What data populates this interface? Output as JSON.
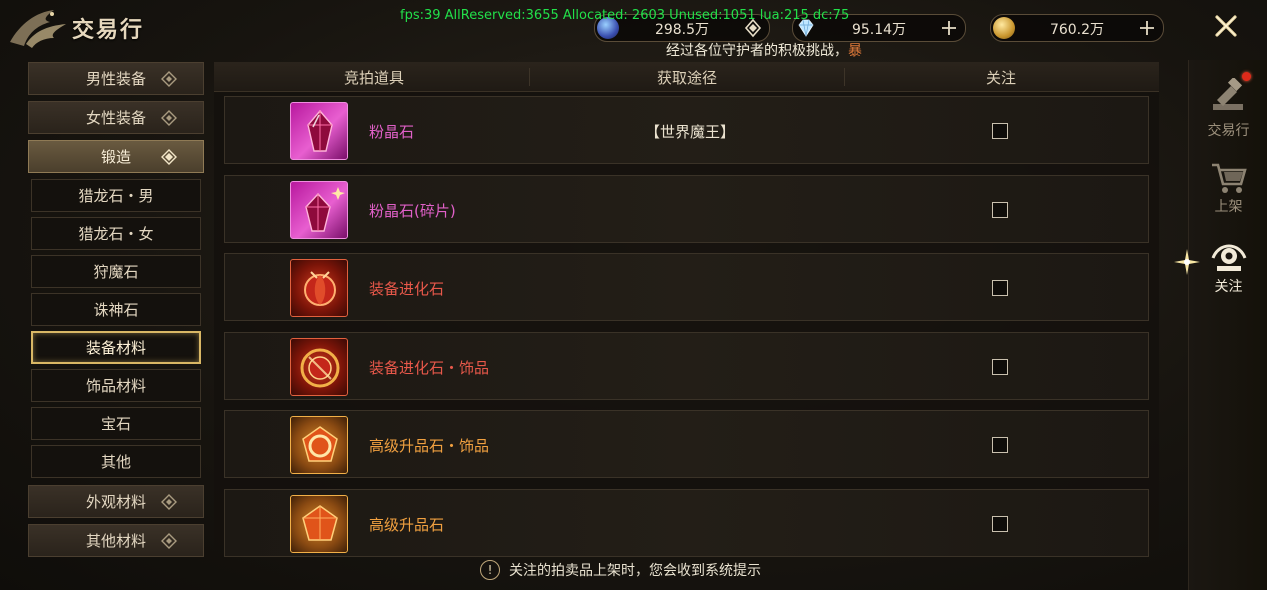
{
  "header": {
    "title": "交易行",
    "debug_overlay": "fps:39 AllReserved:3655 Allocated: 2603 Unused:1051 lua:215 dc:75",
    "notice": {
      "text": "经过各位守护者的积极挑战，",
      "highlight": "暴"
    }
  },
  "currencies": [
    {
      "icon": "blue-orb-icon",
      "value": "298.5万",
      "action": "diamond-chevron-icon"
    },
    {
      "icon": "diamond-icon",
      "value": "95.14万",
      "action": "plus-icon"
    },
    {
      "icon": "gold-coin-icon",
      "value": "760.2万",
      "action": "plus-icon"
    }
  ],
  "categories": [
    {
      "label": "男性装备",
      "type": "group",
      "state": "collapsed"
    },
    {
      "label": "女性装备",
      "type": "group",
      "state": "collapsed"
    },
    {
      "label": "锻造",
      "type": "group",
      "state": "expanded"
    },
    {
      "label": "猎龙石・男",
      "type": "sub"
    },
    {
      "label": "猎龙石・女",
      "type": "sub"
    },
    {
      "label": "狩魔石",
      "type": "sub"
    },
    {
      "label": "诛神石",
      "type": "sub"
    },
    {
      "label": "装备材料",
      "type": "sub",
      "selected": true
    },
    {
      "label": "饰品材料",
      "type": "sub"
    },
    {
      "label": "宝石",
      "type": "sub"
    },
    {
      "label": "其他",
      "type": "sub"
    },
    {
      "label": "外观材料",
      "type": "group",
      "state": "collapsed"
    },
    {
      "label": "其他材料",
      "type": "group",
      "state": "collapsed"
    }
  ],
  "table": {
    "headers": [
      "竞拍道具",
      "获取途径",
      "关注"
    ],
    "rows": [
      {
        "name": "粉晶石",
        "source": "【世界魔王】",
        "name_color": "#e060c8",
        "icon": "pink-crystal-icon",
        "checked": false
      },
      {
        "name": "粉晶石(碎片)",
        "source": "",
        "name_color": "#e060c8",
        "icon": "pink-crystal-fragment-icon",
        "checked": false
      },
      {
        "name": "装备进化石",
        "source": "",
        "name_color": "#e8584a",
        "icon": "red-evolution-stone-icon",
        "checked": false
      },
      {
        "name": "装备进化石・饰品",
        "source": "",
        "name_color": "#e8584a",
        "icon": "red-evolution-ring-icon",
        "checked": false
      },
      {
        "name": "高级升品石・饰品",
        "source": "",
        "name_color": "#f0a040",
        "icon": "orange-upgrade-ring-icon",
        "checked": false
      },
      {
        "name": "高级升品石",
        "source": "",
        "name_color": "#f0a040",
        "icon": "orange-upgrade-stone-icon",
        "checked": false
      }
    ]
  },
  "footer": {
    "hint": "关注的拍卖品上架时，您会收到系统提示"
  },
  "right_tabs": [
    {
      "label": "交易行",
      "icon": "auction-hammer-icon",
      "badge": true,
      "active": false
    },
    {
      "label": "上架",
      "icon": "shopping-cart-icon",
      "badge": false,
      "active": false
    },
    {
      "label": "关注",
      "icon": "eye-icon",
      "badge": false,
      "active": true
    }
  ],
  "colors": {
    "accent_gold": "#d9b765",
    "debug_green": "#22e04a",
    "badge_red": "#e02a1a"
  }
}
